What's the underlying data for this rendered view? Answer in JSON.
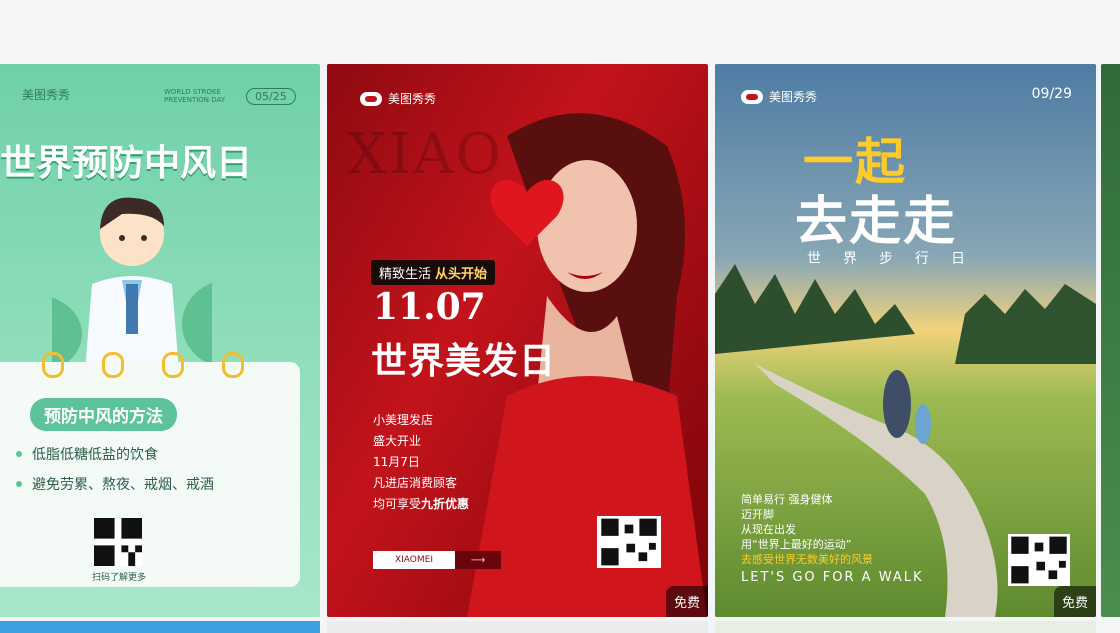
{
  "cards": [
    {
      "brand": "美图秀秀",
      "event_en": "WORLD STROKE PREVENTION DAY",
      "date": "05/25",
      "title": "世界预防中风日",
      "section": "预防中风的方法",
      "items": [
        "低脂低糖低盐的饮食",
        "避免劳累、熬夜、戒烟、戒酒"
      ],
      "qr_caption": "扫码了解更多"
    },
    {
      "brand": "美图秀秀",
      "watermark": "XIAO",
      "tag_a": "精致生活",
      "tag_b": "从头开始",
      "date": "11.07",
      "title": "世界美发日",
      "lines": [
        "小美理发店",
        "盛大开业",
        "11月7日",
        "凡进店消费顾客"
      ],
      "last_line_a": "均可享受",
      "last_line_b": "九折优惠",
      "button_label": "XIAOMEI",
      "button_arrow": "⟶",
      "badge": "免费"
    },
    {
      "brand": "美图秀秀",
      "date": "09/29",
      "title_a": "一起",
      "title_b": "去走走",
      "subtitle": "世界步行日",
      "lines": [
        "简单易行 强身健体",
        "迈开脚",
        "从现在出发",
        "用“世界上最好的运动”"
      ],
      "highlight": "去感受世界无数美好的风景",
      "walk": "LET'S GO FOR A WALK",
      "badge": "免费"
    }
  ]
}
